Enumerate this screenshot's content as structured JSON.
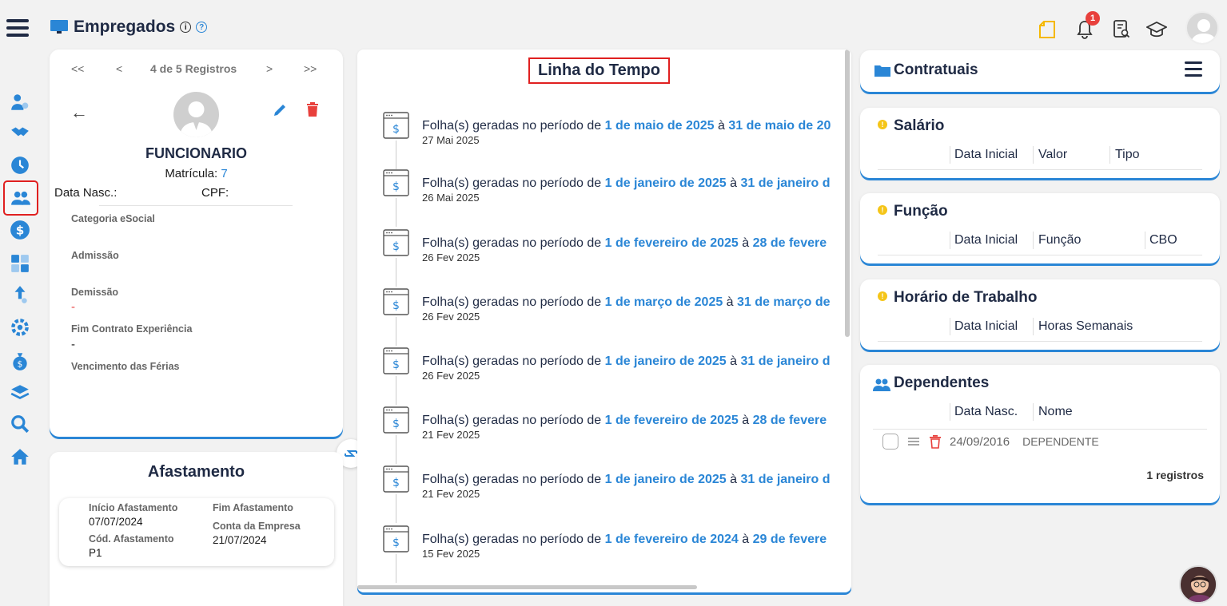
{
  "header": {
    "title": "Empregados",
    "notification_count": "1"
  },
  "employee": {
    "pager_first": "<<",
    "pager_prev": "<",
    "pager_count": "4 de 5 Registros",
    "pager_next": ">",
    "pager_last": ">>",
    "name": "FUNCIONARIO",
    "matricula_label": "Matrícula:",
    "matricula_value": "7",
    "data_nasc_label": "Data Nasc.:",
    "cpf_label": "CPF:",
    "categoria_label": "Categoria eSocial",
    "admissao_label": "Admissão",
    "demissao_label": "Demissão",
    "demissao_value": "-",
    "fim_contrato_label": "Fim Contrato Experiência",
    "fim_contrato_value": "-",
    "vencimento_label": "Vencimento das Férias"
  },
  "afastamento": {
    "title": "Afastamento",
    "inicio_label": "Início Afastamento",
    "inicio_value": "07/07/2024",
    "fim_label": "Fim Afastamento",
    "conta_label": "Conta da Empresa",
    "conta_value": "21/07/2024",
    "cod_label": "Cód. Afastamento",
    "cod_value": "P1"
  },
  "timeline": {
    "title": "Linha do Tempo",
    "items": [
      {
        "prefix": "Folha(s) geradas no período de ",
        "from": "1 de maio de 2025",
        "mid": " à ",
        "to": "31 de maio de 20",
        "date": "27 Mai 2025"
      },
      {
        "prefix": "Folha(s) geradas no período de ",
        "from": "1 de janeiro de 2025",
        "mid": " à ",
        "to": "31 de janeiro d",
        "date": "26 Mai 2025"
      },
      {
        "prefix": "Folha(s) geradas no período de ",
        "from": "1 de fevereiro de 2025",
        "mid": " à ",
        "to": "28 de fevere",
        "date": "26 Fev 2025"
      },
      {
        "prefix": "Folha(s) geradas no período de ",
        "from": "1 de março de 2025",
        "mid": " à ",
        "to": "31 de março de",
        "date": "26 Fev 2025"
      },
      {
        "prefix": "Folha(s) geradas no período de ",
        "from": "1 de janeiro de 2025",
        "mid": " à ",
        "to": "31 de janeiro d",
        "date": "26 Fev 2025"
      },
      {
        "prefix": "Folha(s) geradas no período de ",
        "from": "1 de fevereiro de 2025",
        "mid": " à ",
        "to": "28 de fevere",
        "date": "21 Fev 2025"
      },
      {
        "prefix": "Folha(s) geradas no período de ",
        "from": "1 de janeiro de 2025",
        "mid": " à ",
        "to": "31 de janeiro d",
        "date": "21 Fev 2025"
      },
      {
        "prefix": "Folha(s) geradas no período de ",
        "from": "1 de fevereiro de 2024",
        "mid": " à ",
        "to": "29 de fevere",
        "date": "15 Fev 2025"
      }
    ]
  },
  "contratuais": {
    "title": "Contratuais"
  },
  "salario": {
    "title": "Salário",
    "col1": "Data Inicial",
    "col2": "Valor",
    "col3": "Tipo"
  },
  "funcao": {
    "title": "Função",
    "col1": "Data Inicial",
    "col2": "Função",
    "col3": "CBO"
  },
  "horario": {
    "title": "Horário de Trabalho",
    "col1": "Data Inicial",
    "col2": "Horas Semanais"
  },
  "dependentes": {
    "title": "Dependentes",
    "col1": "Data Nasc.",
    "col2": "Nome",
    "row_date": "24/09/2016",
    "row_name": "DEPENDENTE",
    "count": "1 registros"
  },
  "colors": {
    "accent": "#2a86d6",
    "dark": "#1f2a44",
    "danger": "#e8403c",
    "warning": "#f5c518"
  }
}
